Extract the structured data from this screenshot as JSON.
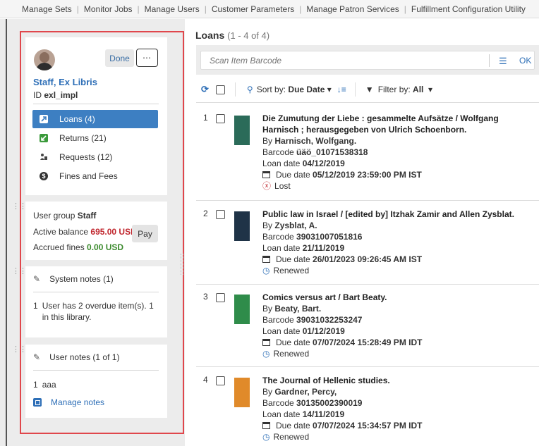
{
  "topnav": {
    "links": [
      "Manage Sets",
      "Monitor Jobs",
      "Manage Users",
      "Customer Parameters",
      "Manage Patron Services",
      "Fulfillment Configuration Utility"
    ]
  },
  "user": {
    "done_label": "Done",
    "more_label": "⋯",
    "name": "Staff, Ex Libris",
    "id_label": "ID",
    "id_value": "exl_impl"
  },
  "menu": {
    "items": [
      {
        "label": "Loans (4)",
        "icon": "loans-icon"
      },
      {
        "label": "Returns (21)",
        "icon": "returns-icon"
      },
      {
        "label": "Requests (12)",
        "icon": "requests-icon"
      },
      {
        "label": "Fines and Fees",
        "icon": "fines-icon"
      }
    ]
  },
  "balance": {
    "group_label": "User group",
    "group_value": "Staff",
    "active_label": "Active balance",
    "active_value": "695.00 USD",
    "pay_label": "Pay",
    "accrued_label": "Accrued fines",
    "accrued_value": "0.00 USD"
  },
  "system_notes": {
    "title": "System notes (1)",
    "note_number": "1",
    "note_text": "User has 2 overdue item(s). 1 in this library."
  },
  "user_notes": {
    "title": "User notes (1 of 1)",
    "note_number": "1",
    "note_text": "aaa",
    "manage_label": "Manage notes"
  },
  "loans": {
    "title": "Loans",
    "range": "(1 - 4 of 4)",
    "scan_placeholder": "Scan Item Barcode",
    "ok_label": "OK",
    "sort_label": "Sort by:",
    "sort_value": "Due Date",
    "filter_label": "Filter by:",
    "filter_value": "All",
    "items": [
      {
        "num": "1",
        "title": "Die Zumutung der Liebe : gesammelte Aufsätze / Wolfgang Harnisch ; herausgegeben von Ulrich Schoenborn.",
        "by_label": "By",
        "author": "Harnisch, Wolfgang.",
        "barcode_label": "Barcode",
        "barcode": "üäö_01071538318",
        "loan_label": "Loan date",
        "loan_date": "04/12/2019",
        "due_label": "Due date",
        "due_date": "05/12/2019 23:59:00 PM IST",
        "status": "Lost",
        "thumb_color": "#2b6b59"
      },
      {
        "num": "2",
        "title": "Public law in Israel / [edited by] Itzhak Zamir and Allen Zysblat.",
        "by_label": "By",
        "author": "Zysblat, A.",
        "barcode_label": "Barcode",
        "barcode": "39031007051816",
        "loan_label": "Loan date",
        "loan_date": "21/11/2019",
        "due_label": "Due date",
        "due_date": "26/01/2023 09:26:45 AM IST",
        "status": "Renewed",
        "thumb_color": "#1f3347"
      },
      {
        "num": "3",
        "title": "Comics versus art / Bart Beaty.",
        "by_label": "By",
        "author": "Beaty, Bart.",
        "barcode_label": "Barcode",
        "barcode": "39031032253247",
        "loan_label": "Loan date",
        "loan_date": "01/12/2019",
        "due_label": "Due date",
        "due_date": "07/07/2024 15:28:49 PM IDT",
        "status": "Renewed",
        "thumb_color": "#2f8c4a"
      },
      {
        "num": "4",
        "title": "The Journal of Hellenic studies.",
        "by_label": "By",
        "author": "Gardner, Percy,",
        "barcode_label": "Barcode",
        "barcode": "30135002390019",
        "loan_label": "Loan date",
        "loan_date": "14/11/2019",
        "due_label": "Due date",
        "due_date": "07/07/2024 15:34:57 PM IDT",
        "status": "Renewed",
        "thumb_color": "#e08a2a"
      }
    ]
  }
}
